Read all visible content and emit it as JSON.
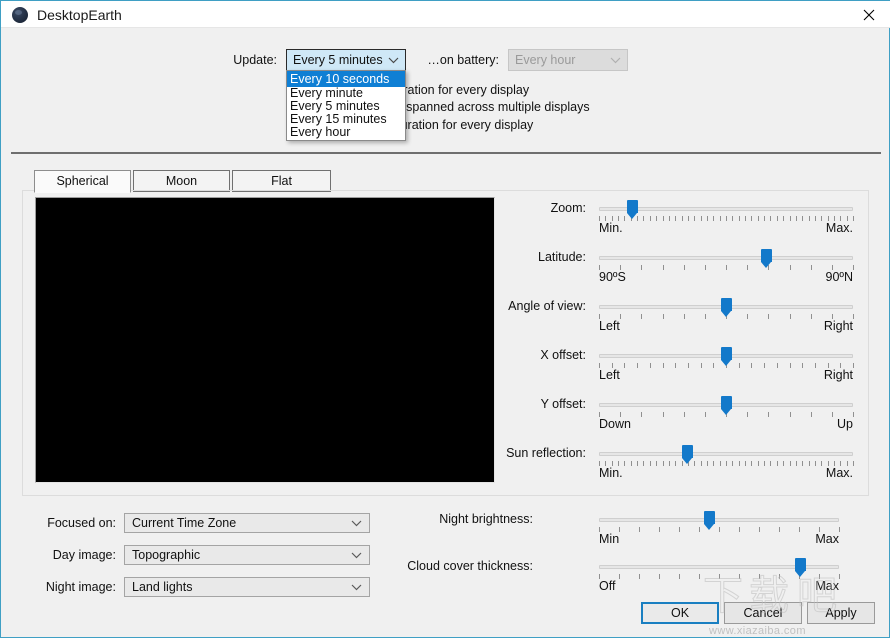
{
  "window": {
    "title": "DesktopEarth",
    "icon": "globe-icon",
    "close_icon": "close-icon",
    "accent_color": "#1379ca",
    "border_color": "#3f9fc4"
  },
  "top": {
    "update_label": "Update:",
    "update_value": "Every 5 minutes",
    "battery_label": "…on battery:",
    "battery_value": "Every hour",
    "battery_disabled": true,
    "update_options": [
      "Every 10 seconds",
      "Every minute",
      "Every 5 minutes",
      "Every 15 minutes",
      "Every hour"
    ],
    "update_highlighted_index": 0,
    "display_options": [
      "The same configuration for every display",
      "One configuration spanned across multiple displays",
      "A separate configuration for every display"
    ],
    "display_selected_index": 0
  },
  "tabs": [
    {
      "label": "Spherical",
      "active": true
    },
    {
      "label": "Moon",
      "active": false
    },
    {
      "label": "Flat",
      "active": false
    }
  ],
  "preview": {
    "name": "globe-preview",
    "background": "#000000"
  },
  "sliders": [
    {
      "label": "Zoom:",
      "min_label": "Min.",
      "max_label": "Max.",
      "value_pct": 13,
      "ticks": 41
    },
    {
      "label": "Latitude:",
      "min_label": "90ºS",
      "max_label": "90ºN",
      "value_pct": 66,
      "ticks": 13
    },
    {
      "label": "Angle of view:",
      "min_label": "Left",
      "max_label": "Right",
      "value_pct": 50,
      "ticks": 13
    },
    {
      "label": "X offset:",
      "min_label": "Left",
      "max_label": "Right",
      "value_pct": 50,
      "ticks": 21
    },
    {
      "label": "Y offset:",
      "min_label": "Down",
      "max_label": "Up",
      "value_pct": 50,
      "ticks": 13
    },
    {
      "label": "Sun reflection:",
      "min_label": "Min.",
      "max_label": "Max.",
      "value_pct": 35,
      "ticks": 41
    }
  ],
  "bottom_sliders": [
    {
      "label": "Night brightness:",
      "min_label": "Min",
      "max_label": "Max",
      "value_pct": 46,
      "ticks": 13
    },
    {
      "label": "Cloud cover thickness:",
      "min_label": "Off",
      "max_label": "Max",
      "value_pct": 84,
      "ticks": 13
    }
  ],
  "bottom_combos": [
    {
      "label": "Focused on:",
      "value": "Current Time Zone"
    },
    {
      "label": "Day image:",
      "value": "Topographic"
    },
    {
      "label": "Night image:",
      "value": "Land lights"
    }
  ],
  "buttons": {
    "ok": "OK",
    "cancel": "Cancel",
    "apply": "Apply"
  },
  "watermark": {
    "url": "www.xiazaiba.com",
    "glyphs": "下载吧"
  }
}
